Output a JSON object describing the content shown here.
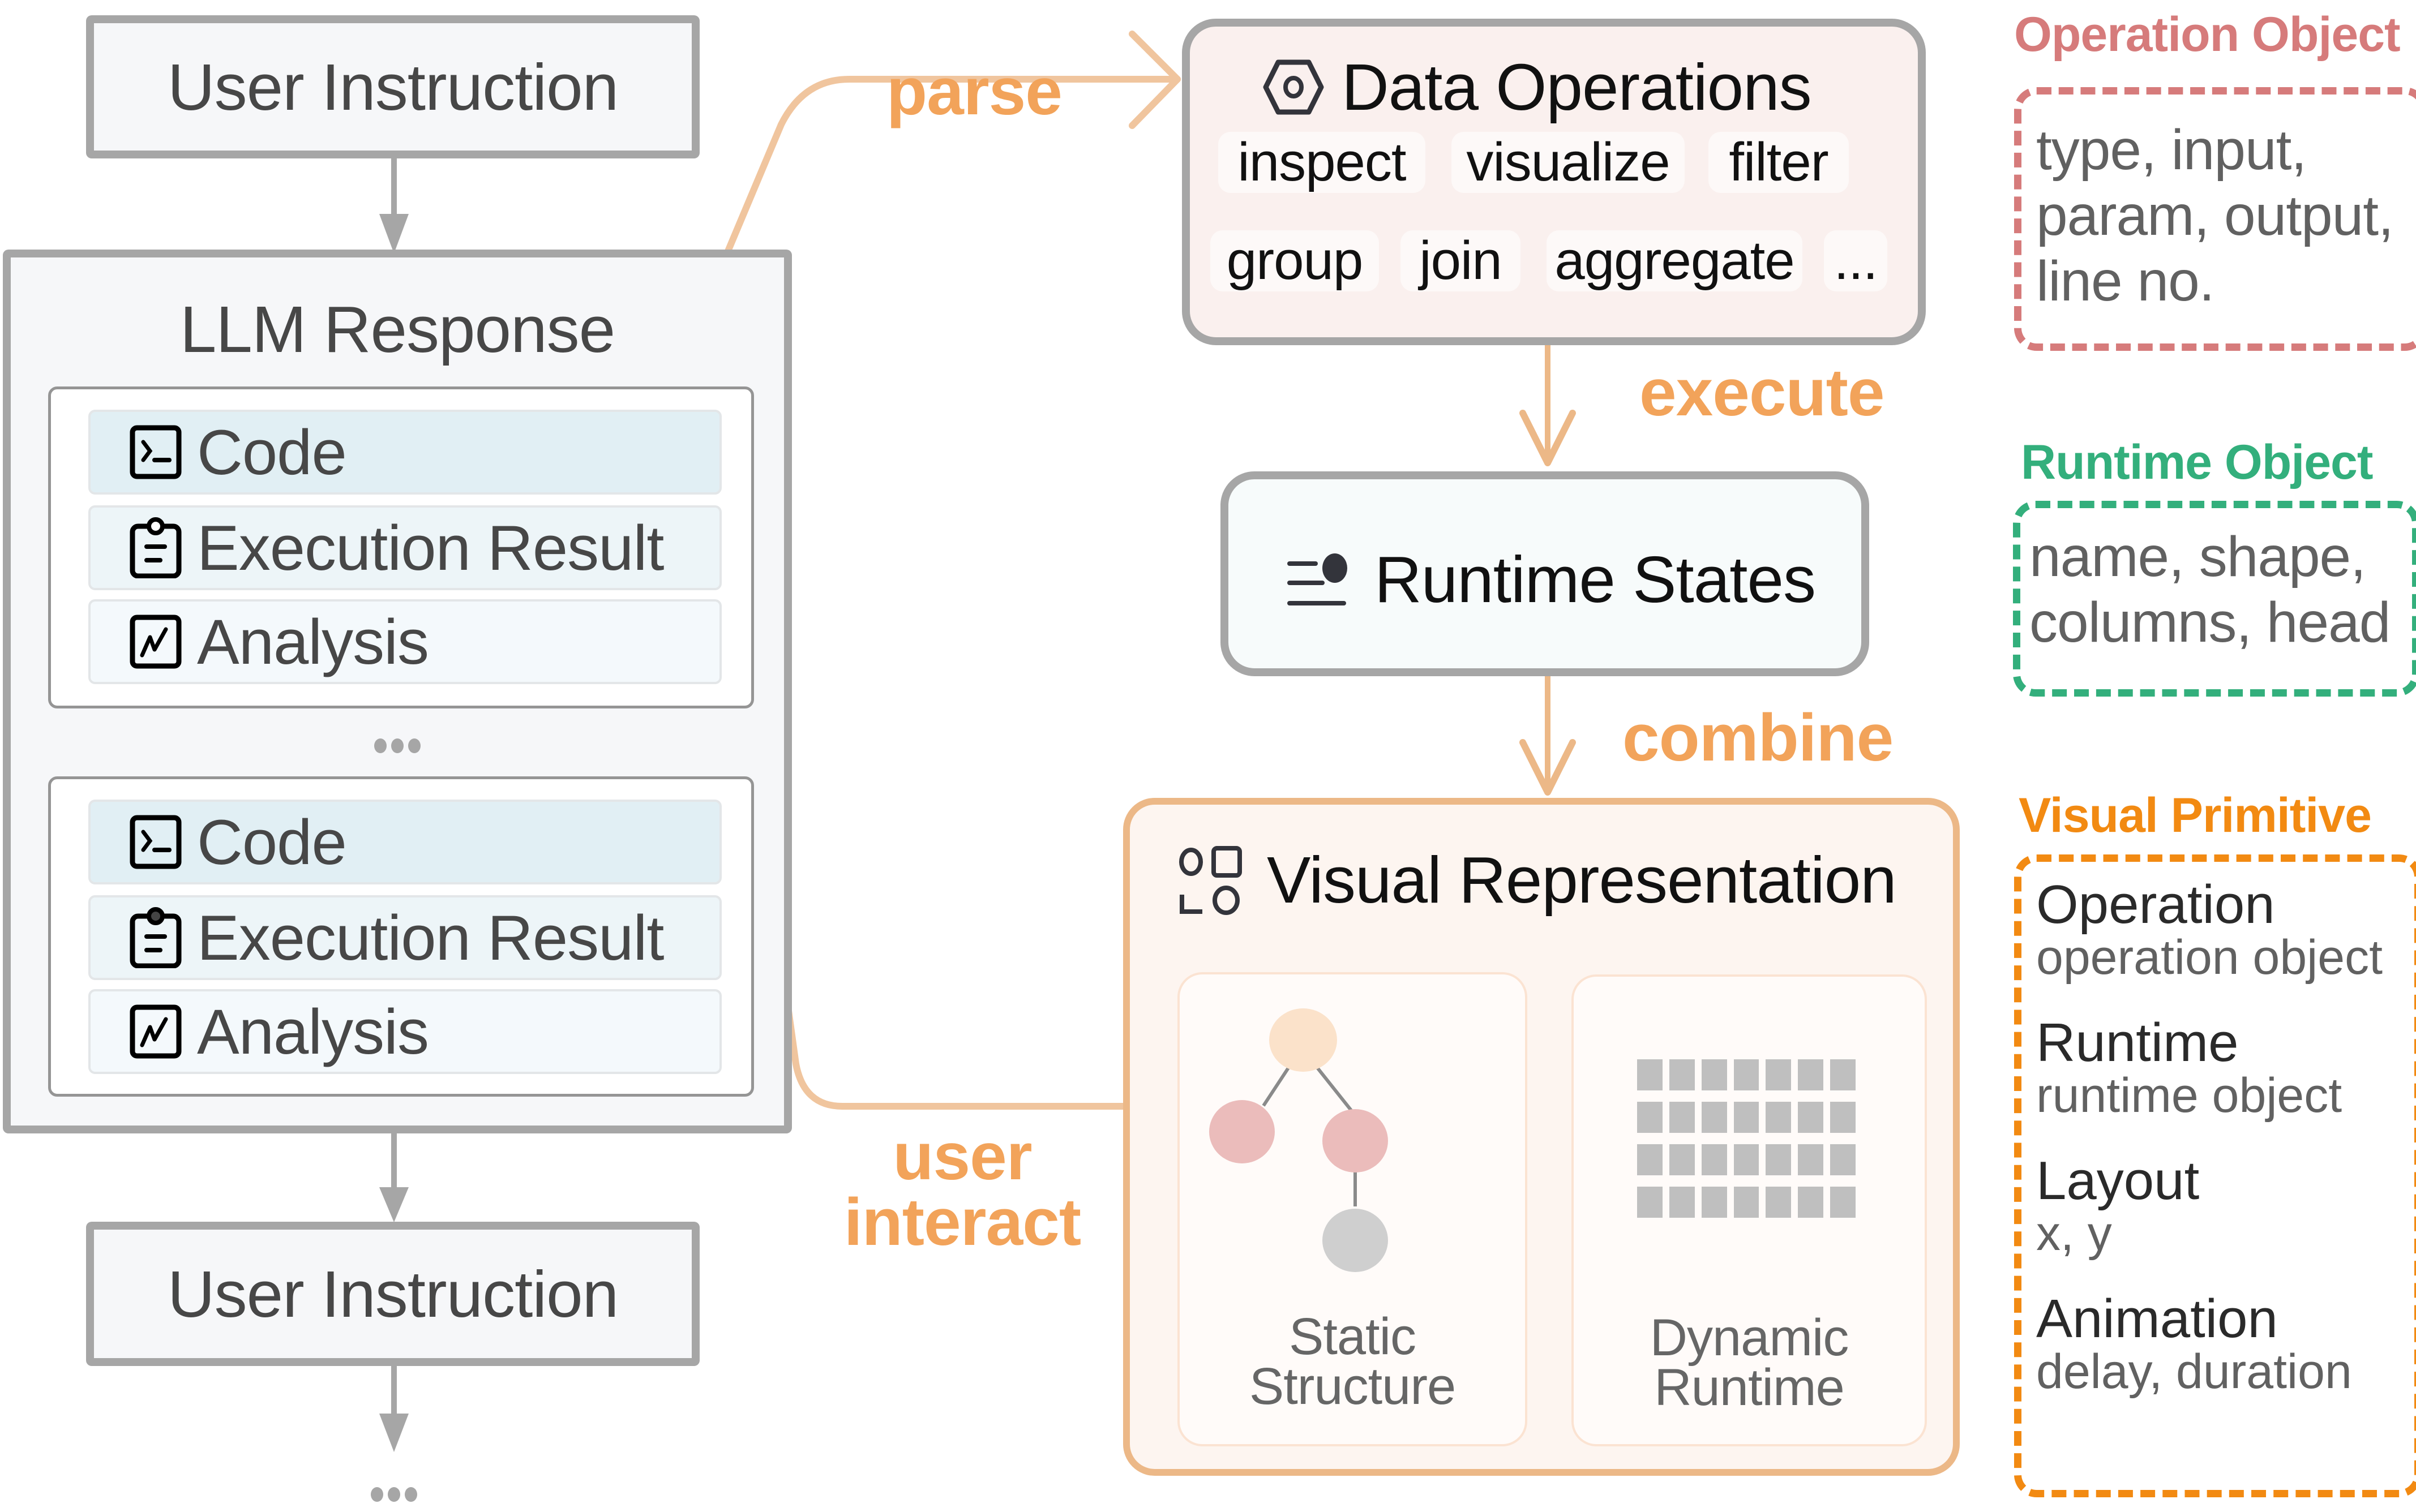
{
  "colors": {
    "flow_orange": "#f2a35a",
    "arrow_orange": "#f0c59e",
    "gray_arrow": "#a6a6a6",
    "operation_object": "#d67b7b",
    "runtime_object": "#33af7c",
    "visual_primitive": "#f28a12"
  },
  "left_flow": {
    "user_instruction_top": "User Instruction",
    "llm_response": {
      "title": "LLM Response",
      "groups": [
        {
          "items": [
            {
              "icon": "terminal-icon",
              "label": "Code"
            },
            {
              "icon": "clipboard-icon",
              "label": "Execution Result"
            },
            {
              "icon": "chart-line-icon",
              "label": "Analysis"
            }
          ]
        },
        {
          "items": [
            {
              "icon": "terminal-icon",
              "label": "Code"
            },
            {
              "icon": "clipboard-icon",
              "label": "Execution Result"
            },
            {
              "icon": "chart-line-icon",
              "label": "Analysis"
            }
          ]
        }
      ],
      "ellipsis": "..."
    },
    "user_instruction_bottom": "User Instruction",
    "ellipsis_bottom": "..."
  },
  "flow_labels": {
    "parse": "parse",
    "execute": "execute",
    "combine": "combine",
    "user_interact_line1": "user",
    "user_interact_line2": "interact"
  },
  "data_operations": {
    "icon": "hexagon-nut-icon",
    "title": "Data Operations",
    "chips_row1": [
      "inspect",
      "visualize",
      "filter"
    ],
    "chips_row2": [
      "group",
      "join",
      "aggregate",
      "..."
    ]
  },
  "runtime_states": {
    "icon": "list-dot-icon",
    "title": "Runtime States"
  },
  "visual_representation": {
    "icon": "shapes-icon",
    "title": "Visual Representation",
    "panels": [
      {
        "caption_line1": "Static",
        "caption_line2": "Structure",
        "graphic": "tree-graph"
      },
      {
        "caption_line1": "Dynamic",
        "caption_line2": "Runtime",
        "graphic": "grid-cells"
      }
    ],
    "grid": {
      "rows": 4,
      "cols": 7
    }
  },
  "annotations": {
    "operation_object": {
      "title": "Operation Object",
      "lines": [
        "type, input,",
        "param, output,",
        "line no."
      ]
    },
    "runtime_object": {
      "title": "Runtime Object",
      "lines": [
        "name, shape,",
        "columns, head"
      ]
    },
    "visual_primitive": {
      "title": "Visual Primitive",
      "items": [
        {
          "name": "Operation",
          "detail": "operation object"
        },
        {
          "name": "Runtime",
          "detail": "runtime object"
        },
        {
          "name": "Layout",
          "detail": "x, y"
        },
        {
          "name": "Animation",
          "detail": "delay, duration"
        }
      ]
    }
  }
}
